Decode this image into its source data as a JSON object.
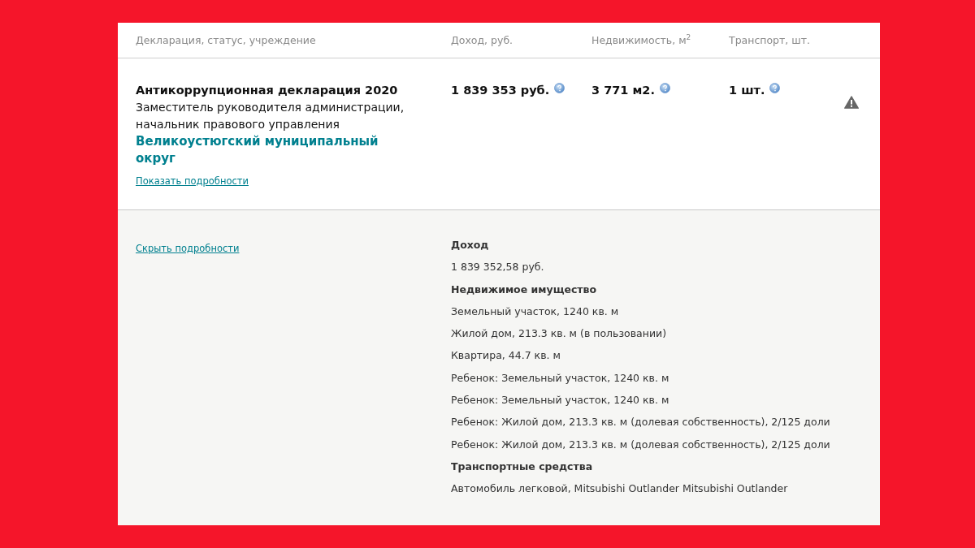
{
  "table": {
    "columns": [
      "Декларация, статус, учреждение",
      "Доход, руб.",
      "Недвижимость, м$^{2}$",
      "Транспорт, шт."
    ],
    "rows": [
      {
        "title": "Антикоррупционная декларация 2020",
        "position": "Заместитель руководителя администрации, начальник правового управления",
        "organization": "Великоустюгский муниципальный округ",
        "details_link": "Показать подробности",
        "income": "1 839 353 руб.",
        "real_estate": "3 771 м2.",
        "transport": "1 шт."
      }
    ]
  },
  "details": {
    "link": "Скрыть подробности",
    "items": [
      {
        "kind": "heading",
        "text": "Доход"
      },
      {
        "kind": "text",
        "text": "1 839 352,58 руб."
      },
      {
        "kind": "heading",
        "text": "Недвижимое имущество"
      },
      {
        "kind": "text",
        "text": "Земельный участок, 1240 кв. м"
      },
      {
        "kind": "text",
        "text": "Жилой дом, 213.3 кв. м (в пользовании)"
      },
      {
        "kind": "text",
        "text": "Квартира, 44.7 кв. м"
      },
      {
        "kind": "text",
        "text": "Ребенок: Земельный участок, 1240 кв. м"
      },
      {
        "kind": "text",
        "text": "Ребенок: Земельный участок, 1240 кв. м"
      },
      {
        "kind": "text",
        "text": "Ребенок: Жилой дом, 213.3 кв. м (долевая собственность), 2/125 доли"
      },
      {
        "kind": "text",
        "text": "Ребенок: Жилой дом, 213.3 кв. м (долевая собственность), 2/125 доли"
      },
      {
        "kind": "heading",
        "text": "Транспортные средства"
      },
      {
        "kind": "text",
        "text": "Автомобиль легковой, Mitsubishi Outlander Mitsubishi Outlander"
      }
    ]
  }
}
